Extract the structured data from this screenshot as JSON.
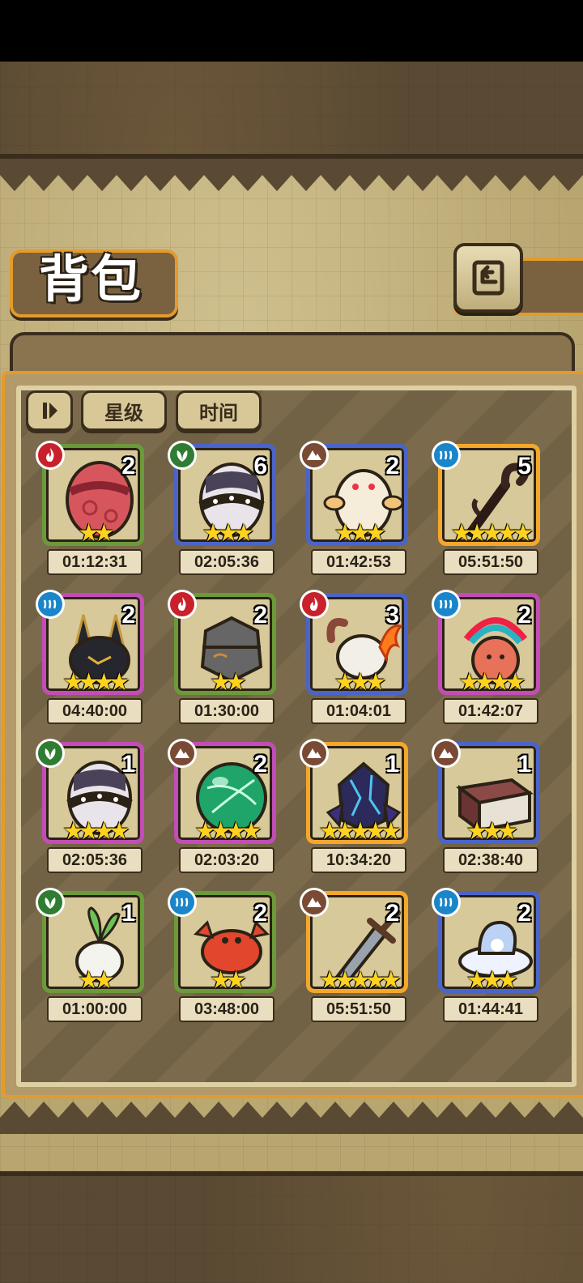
{
  "header": {
    "title": "背包"
  },
  "filters": {
    "stars_label": "星级",
    "time_label": "时间"
  },
  "items": [
    {
      "count": "2",
      "time": "01:12:31",
      "element": "fire",
      "stars": "★★",
      "frame": "green",
      "art": "red-egg"
    },
    {
      "count": "6",
      "time": "02:05:36",
      "element": "leaf",
      "stars": "★★★",
      "frame": "blue",
      "art": "spiked-egg"
    },
    {
      "count": "2",
      "time": "01:42:53",
      "element": "earth",
      "stars": "★★★",
      "frame": "blue",
      "art": "fluffy-creature"
    },
    {
      "count": "5",
      "time": "05:51:50",
      "element": "water",
      "stars": "★★★★★",
      "frame": "gold",
      "art": "dark-staff"
    },
    {
      "count": "2",
      "time": "04:40:00",
      "element": "water",
      "stars": "★★★★",
      "frame": "purple",
      "art": "dark-rabbit"
    },
    {
      "count": "2",
      "time": "01:30:00",
      "element": "fire",
      "stars": "★★",
      "frame": "green",
      "art": "stone-egg"
    },
    {
      "count": "3",
      "time": "01:04:01",
      "element": "fire",
      "stars": "★★★",
      "frame": "blue",
      "art": "fire-tail"
    },
    {
      "count": "2",
      "time": "01:42:07",
      "element": "water",
      "stars": "★★★★",
      "frame": "purple",
      "art": "feather-bird"
    },
    {
      "count": "1",
      "time": "02:05:36",
      "element": "leaf",
      "stars": "★★★★",
      "frame": "purple",
      "art": "spiked-egg"
    },
    {
      "count": "2",
      "time": "02:03:20",
      "element": "earth",
      "stars": "★★★★",
      "frame": "purple",
      "art": "green-orb"
    },
    {
      "count": "1",
      "time": "10:34:20",
      "element": "earth",
      "stars": "★★★★★",
      "frame": "gold",
      "art": "crystal-egg"
    },
    {
      "count": "1",
      "time": "02:38:40",
      "element": "earth",
      "stars": "★★★",
      "frame": "blue",
      "art": "book"
    },
    {
      "count": "1",
      "time": "01:00:00",
      "element": "leaf",
      "stars": "★★",
      "frame": "green",
      "art": "radish"
    },
    {
      "count": "2",
      "time": "03:48:00",
      "element": "water",
      "stars": "★★",
      "frame": "green",
      "art": "crab"
    },
    {
      "count": "2",
      "time": "05:51:50",
      "element": "earth",
      "stars": "★★★★★",
      "frame": "gold",
      "art": "sword"
    },
    {
      "count": "2",
      "time": "01:44:41",
      "element": "water",
      "stars": "★★★",
      "frame": "blue",
      "art": "cloud-shell"
    }
  ]
}
